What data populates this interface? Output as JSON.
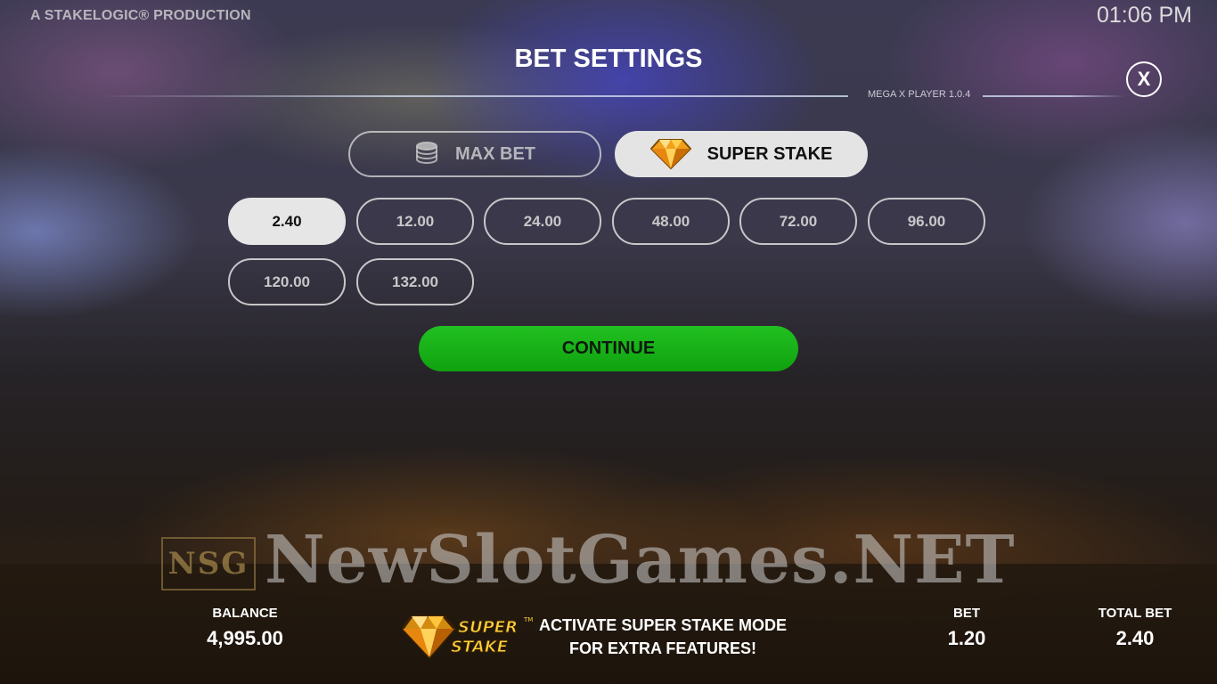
{
  "header": {
    "brand": "A STAKELOGIC® PRODUCTION",
    "clock": "01:06 PM"
  },
  "dialog": {
    "title": "BET SETTINGS",
    "version": "MEGA X PLAYER 1.0.4",
    "close_label": "X",
    "modes": {
      "max_bet": "MAX BET",
      "super_stake": "SUPER STAKE",
      "active": "super_stake"
    },
    "bets": [
      "2.40",
      "12.00",
      "24.00",
      "48.00",
      "72.00",
      "96.00",
      "120.00",
      "132.00"
    ],
    "selected_bet": "2.40",
    "continue_label": "CONTINUE"
  },
  "watermark": {
    "logo_text": "NSG",
    "text": "NewSlotGames.NET"
  },
  "footer": {
    "balance_label": "BALANCE",
    "balance_value": "4,995.00",
    "promo_line1": "ACTIVATE SUPER STAKE MODE",
    "promo_line2": "FOR EXTRA FEATURES!",
    "logo_text_1": "SUPER",
    "logo_text_2": "STAKE",
    "logo_tm": "TM",
    "bet_label": "BET",
    "bet_value": "1.20",
    "total_bet_label": "TOTAL BET",
    "total_bet_value": "2.40"
  },
  "colors": {
    "continue_green": "#1bb51a",
    "selected_bg": "#e6e6e6",
    "gem_gold": "#f5a623"
  }
}
